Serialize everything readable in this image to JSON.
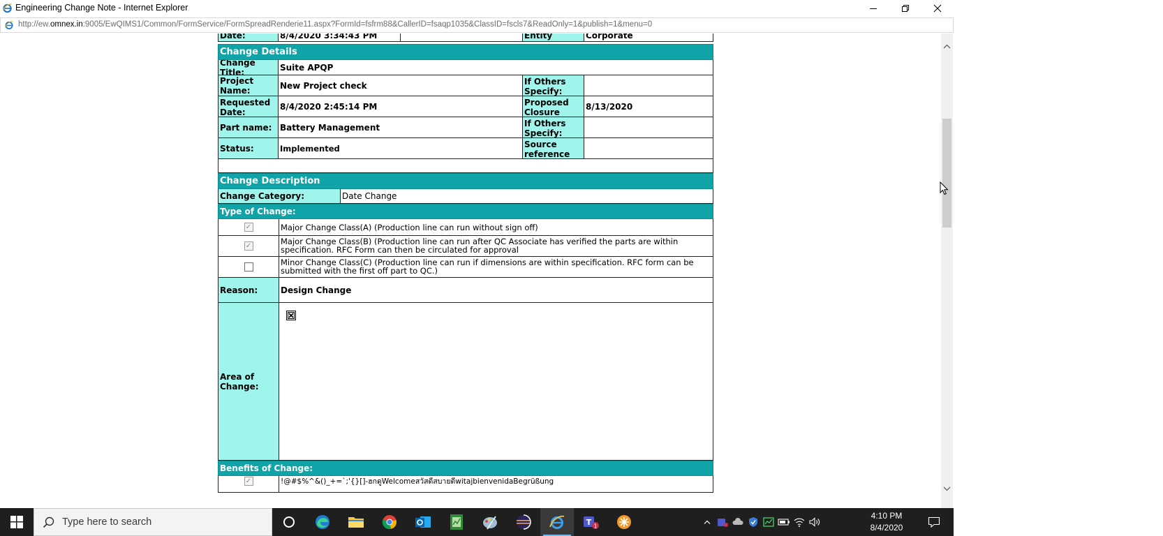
{
  "window": {
    "title": "Engineering Change Note - Internet Explorer",
    "address_prefix": "http://ew.",
    "address_host": "omnex.in",
    "address_rest": ":9005/EwQIMS1/Common/FormService/FormSpreadRenderie11.aspx?FormId=fsfrm88&CallerID=fsaqp1035&ClassID=fscls7&ReadOnly=1&publish=1&menu=0"
  },
  "form": {
    "top_row": {
      "date_label": "Date:",
      "date_value": "8/4/2020 3:34:43 PM",
      "entity_label": "Entity",
      "entity_value": "Corporate"
    },
    "change_details": {
      "section_title": "Change Details",
      "change_title_label": "Change Title:",
      "change_title_value": "Suite APQP",
      "project_name_label": "Project Name:",
      "project_name_value": "New Project check",
      "if_others_label_1": "If Others Specify:",
      "if_others_value_1": "",
      "requested_date_label": "Requested Date:",
      "requested_date_value": "8/4/2020 2:45:14 PM",
      "proposed_closure_label": "Proposed Closure Date:",
      "proposed_closure_value": "8/13/2020",
      "part_name_label": "Part name:",
      "part_name_value": "Battery Management",
      "if_others_label_2": "If Others Specify:",
      "if_others_value_2": "",
      "status_label": "Status:",
      "status_value": "Implemented",
      "source_ref_label": "Source reference #:",
      "source_ref_value": ""
    },
    "change_description": {
      "section_title": "Change Description",
      "category_label": "Change Category:",
      "category_value": "Date Change",
      "type_title": "Type of Change:",
      "types": [
        {
          "checked": true,
          "text": "Major Change Class(A) (Production line can run without sign off)"
        },
        {
          "checked": true,
          "text": "Major Change Class(B) (Production line can run after QC Associate has verified the parts are within specification. RFC Form can then be circulated for approval"
        },
        {
          "checked": false,
          "text": "Minor Change Class(C) (Production line can run if dimensions are within specification. RFC form can be submitted with the first off part to QC.)"
        }
      ],
      "reason_label": "Reason:",
      "reason_value": "Design Change",
      "area_label": "Area of Change:",
      "benefits_title": "Benefits of Change:",
      "benefits_text": "!@#$%^&()_+=`;'{}[]-ฮกดูWelcomeสวัสดีสบายดีwitajbienvenidaBegrüßung"
    }
  },
  "taskbar": {
    "search_placeholder": "Type here to search",
    "time": "4:10 PM",
    "date": "8/4/2020",
    "teams_badge": "1"
  }
}
